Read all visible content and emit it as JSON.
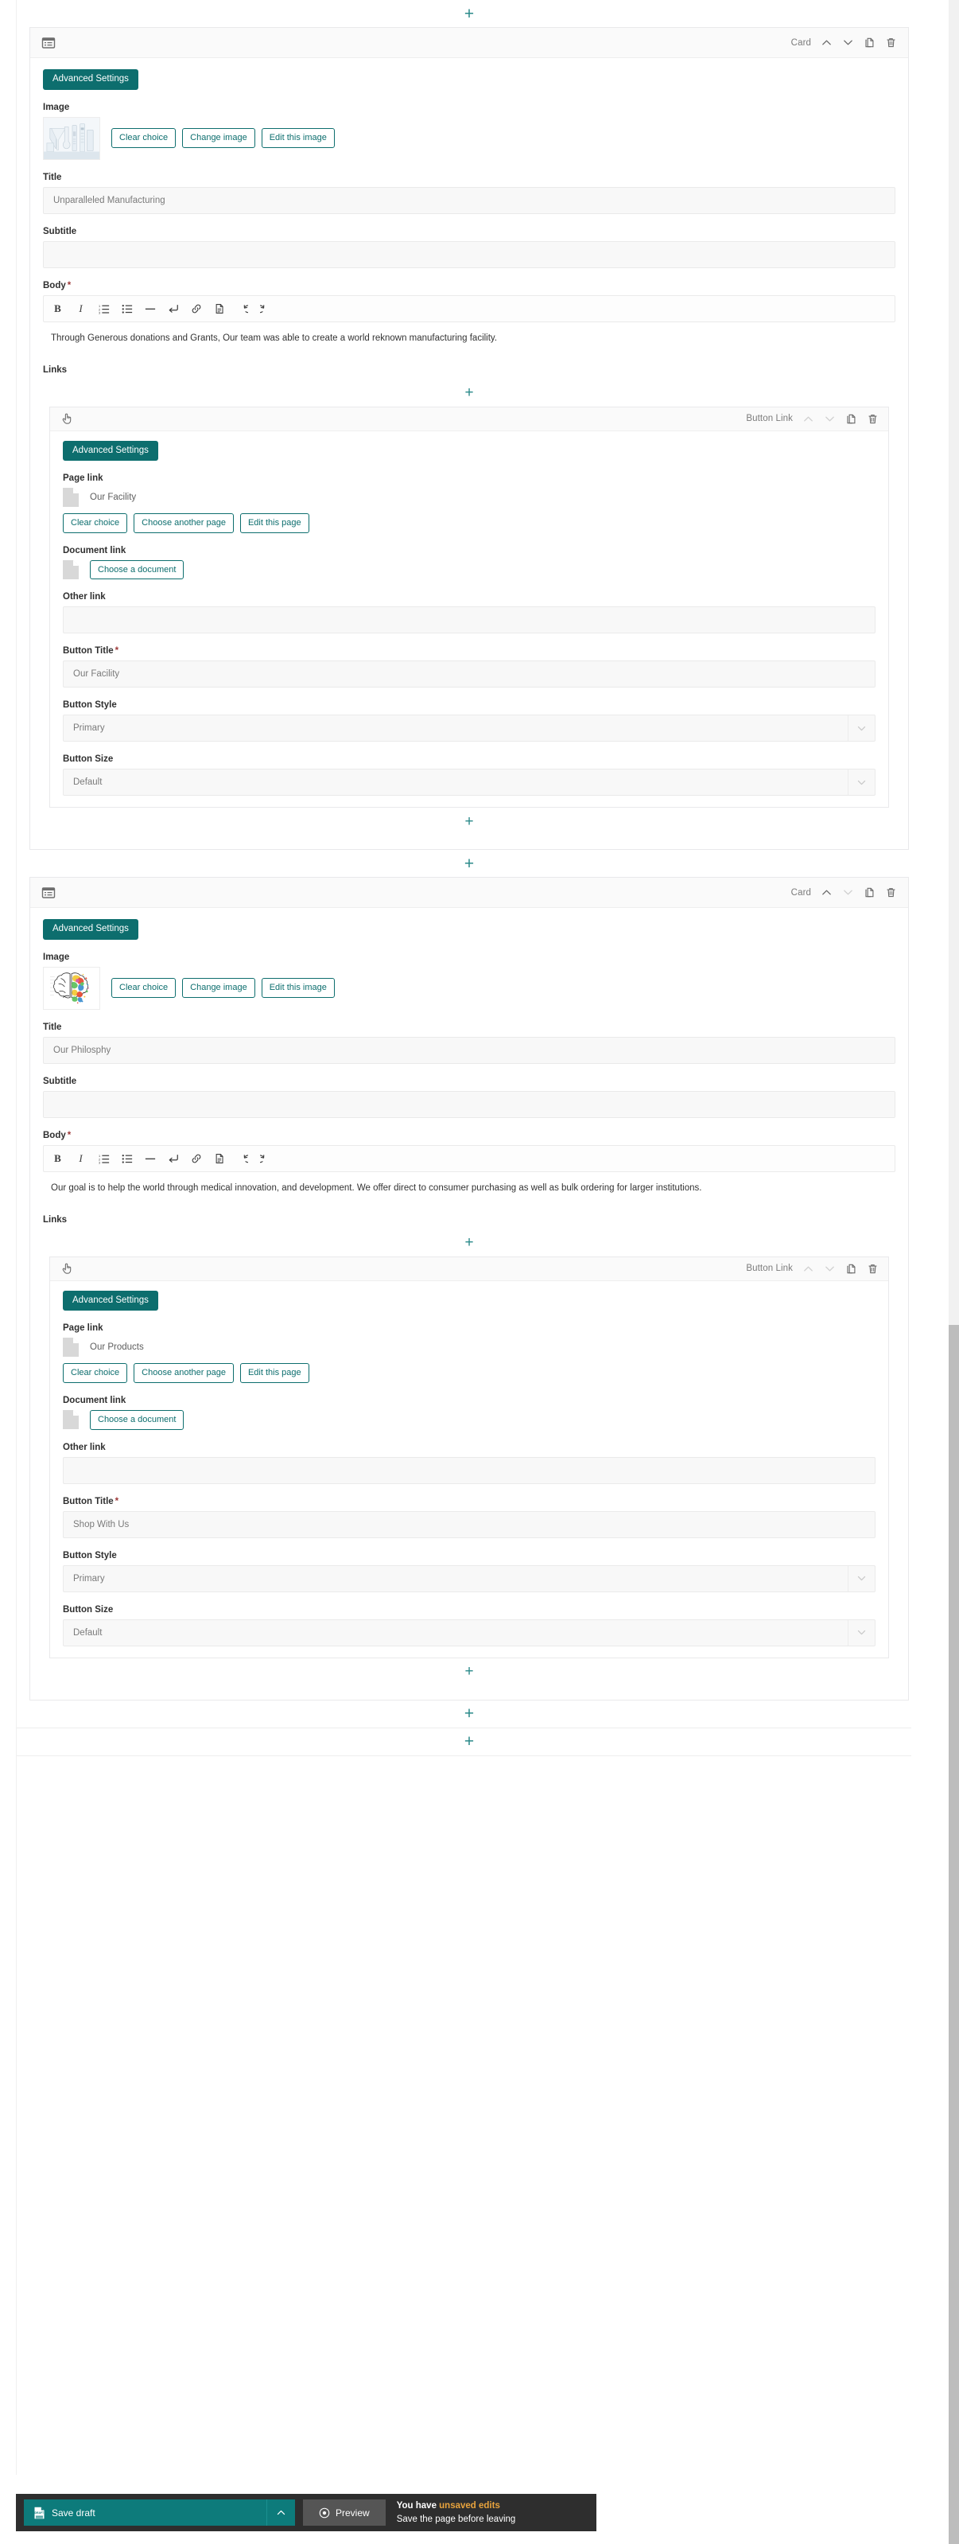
{
  "add_button": {
    "glyph": "+",
    "label": "Add content",
    "color": "#2b8a8a"
  },
  "blocks": [
    {
      "type_label": "Card",
      "type_icon": "card-list-icon",
      "advanced_settings_label": "Advanced Settings",
      "image": {
        "label": "Image",
        "alt": "laboratory glassware beakers and flasks",
        "buttons": [
          "Clear choice",
          "Change image",
          "Edit this image"
        ]
      },
      "title": {
        "label": "Title",
        "value": "Unparalleled Manufacturing"
      },
      "subtitle": {
        "label": "Subtitle",
        "value": ""
      },
      "body": {
        "label": "Body",
        "required": "*",
        "text": "Through Generous donations and Grants, Our team was able to create a world reknown manufacturing facility."
      },
      "links_label": "Links",
      "inner": {
        "type_label": "Button Link",
        "type_icon": "pointing-hand-icon",
        "advanced_settings_label": "Advanced Settings",
        "page_link": {
          "label": "Page link",
          "value": "Our Facility",
          "buttons": [
            "Clear choice",
            "Choose another page",
            "Edit this page"
          ]
        },
        "document_link": {
          "label": "Document link",
          "button": "Choose a document"
        },
        "other_link": {
          "label": "Other link",
          "value": ""
        },
        "button_title": {
          "label": "Button Title",
          "required": "*",
          "value": "Our Facility"
        },
        "button_style": {
          "label": "Button Style",
          "value": "Primary"
        },
        "button_size": {
          "label": "Button Size",
          "value": "Default"
        }
      }
    },
    {
      "type_label": "Card",
      "type_icon": "card-list-icon",
      "advanced_settings_label": "Advanced Settings",
      "image": {
        "label": "Image",
        "alt": "colorful split brain illustration",
        "buttons": [
          "Clear choice",
          "Change image",
          "Edit this image"
        ]
      },
      "title": {
        "label": "Title",
        "value": "Our Philosphy"
      },
      "subtitle": {
        "label": "Subtitle",
        "value": ""
      },
      "body": {
        "label": "Body",
        "required": "*",
        "text": "Our goal is to help the world through medical innovation, and development. We offer direct to consumer purchasing as well as bulk ordering for larger institutions."
      },
      "links_label": "Links",
      "inner": {
        "type_label": "Button Link",
        "type_icon": "pointing-hand-icon",
        "advanced_settings_label": "Advanced Settings",
        "page_link": {
          "label": "Page link",
          "value": "Our Products",
          "buttons": [
            "Clear choice",
            "Choose another page",
            "Edit this page"
          ]
        },
        "document_link": {
          "label": "Document link",
          "button": "Choose a document"
        },
        "other_link": {
          "label": "Other link",
          "value": ""
        },
        "button_title": {
          "label": "Button Title",
          "required": "*",
          "value": "Shop With Us"
        },
        "button_style": {
          "label": "Button Style",
          "value": "Primary"
        },
        "button_size": {
          "label": "Button Size",
          "value": "Default"
        }
      }
    }
  ],
  "rte_toolbar": {
    "buttons": [
      {
        "name": "bold-icon",
        "glyph": "B"
      },
      {
        "name": "italic-icon",
        "glyph": "I"
      },
      {
        "name": "ordered-list-icon",
        "glyph": ""
      },
      {
        "name": "unordered-list-icon",
        "glyph": ""
      },
      {
        "name": "horizontal-rule-icon",
        "glyph": ""
      },
      {
        "name": "line-break-icon",
        "glyph": ""
      },
      {
        "name": "link-icon",
        "glyph": ""
      },
      {
        "name": "embed-document-icon",
        "glyph": ""
      },
      {
        "name": "undo-icon",
        "glyph": ""
      },
      {
        "name": "redo-icon",
        "glyph": ""
      }
    ]
  },
  "block_header_tools": {
    "move_up": "move-up-icon",
    "move_down": "move-down-icon",
    "copy": "copy-icon",
    "delete": "delete-icon"
  },
  "savebar": {
    "save_draft_label": "Save draft",
    "preview_label": "Preview",
    "status_line1_bold": "You have ",
    "status_line1_warn": "unsaved edits",
    "status_line2": "Save the page before leaving"
  },
  "colors": {
    "accent_teal": "#0d6e6e",
    "plus_teal": "#2b8a8a",
    "warn_amber": "#e8a33d",
    "savebar_bg": "#2e2e2e"
  }
}
